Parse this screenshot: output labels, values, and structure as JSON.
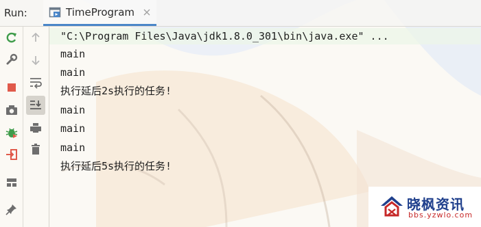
{
  "header": {
    "run_label": "Run:",
    "tab_title": "TimeProgram"
  },
  "toolbar_left": {
    "icons": [
      "rerun-icon",
      "wrench-icon",
      "stop-icon",
      "camera-icon",
      "debug-icon",
      "exit-icon",
      "layout-icon",
      "pin-icon"
    ]
  },
  "toolbar_right": {
    "icons": [
      "up-arrow-icon",
      "down-arrow-icon",
      "soft-wrap-icon",
      "scroll-to-end-icon",
      "print-icon",
      "trash-icon"
    ]
  },
  "console": {
    "lines": [
      "\"C:\\Program Files\\Java\\jdk1.8.0_301\\bin\\java.exe\" ...",
      "main",
      "main",
      "执行延后2s执行的任务!",
      "main",
      "main",
      "main",
      "执行延后5s执行的任务!"
    ]
  },
  "watermark": {
    "title": "晓枫资讯",
    "url": "bbs.yzwlo.com"
  },
  "colors": {
    "accent": "#4a86c8",
    "run_green": "#3f9c4b",
    "stop_red": "#e05a4b"
  }
}
